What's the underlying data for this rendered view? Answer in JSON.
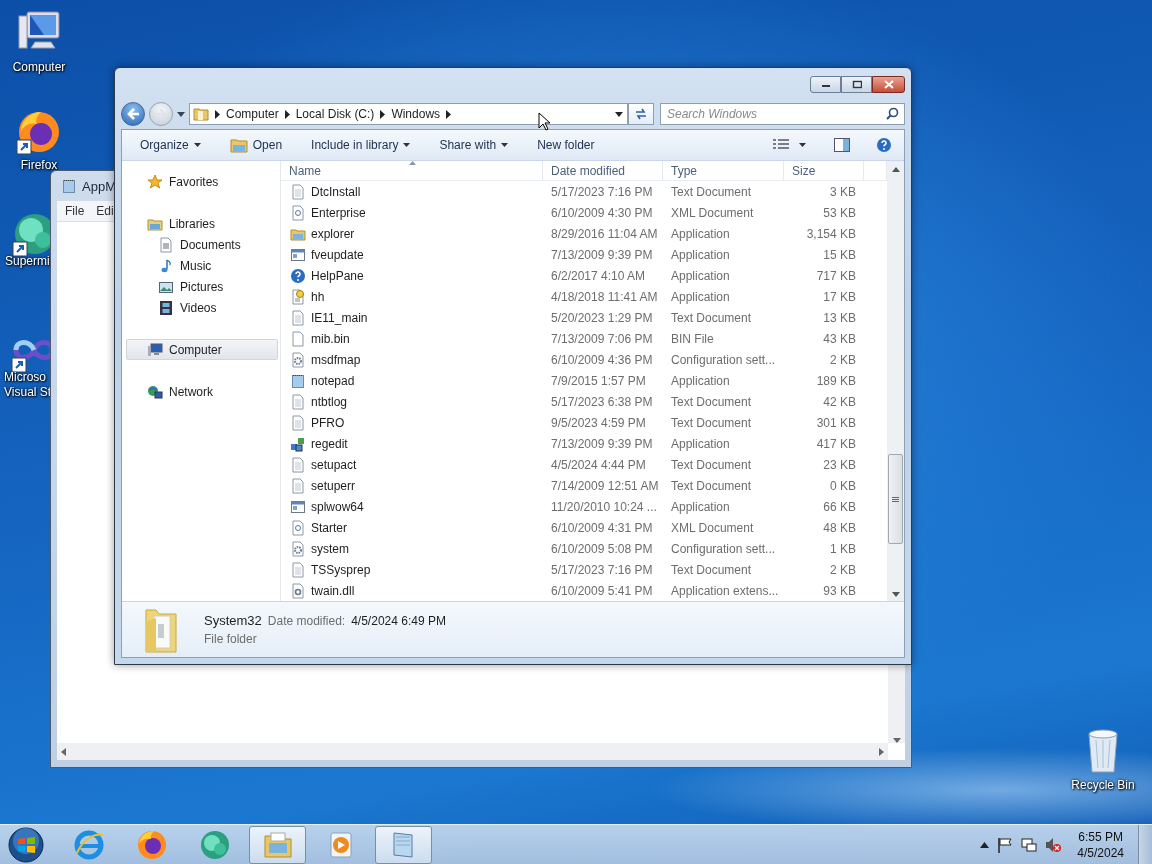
{
  "desktop_icons": [
    {
      "kind": "computer",
      "lines": [
        "Computer"
      ]
    },
    {
      "kind": "browser",
      "lines": [
        "Firefox"
      ]
    },
    {
      "kind": "app",
      "lines": [
        "Supermi"
      ]
    },
    {
      "kind": "studio",
      "lines": [
        "Microso",
        "Visual St"
      ]
    }
  ],
  "background_window": {
    "title": "AppM",
    "menu": [
      "File",
      "Edi"
    ]
  },
  "explorer": {
    "breadcrumbs": [
      "Computer",
      "Local Disk (C:)",
      "Windows"
    ],
    "search": {
      "placeholder": "Search Windows"
    },
    "toolbar": [
      {
        "label": "Organize",
        "kind": "menu"
      },
      {
        "label": "Open",
        "kind": "open"
      },
      {
        "label": "Include in library",
        "kind": "menu"
      },
      {
        "label": "Share with",
        "kind": "menu"
      },
      {
        "label": "New folder",
        "kind": "plain"
      }
    ],
    "nav": [
      {
        "label": "Favorites",
        "kind": "star",
        "selected": false
      },
      {
        "label": "Libraries",
        "kind": "library",
        "selected": false,
        "children": [
          {
            "label": "Documents",
            "kind": "documents",
            "selected": false
          },
          {
            "label": "Music",
            "kind": "music",
            "selected": false
          },
          {
            "label": "Pictures",
            "kind": "pictures",
            "selected": false
          },
          {
            "label": "Videos",
            "kind": "videos",
            "selected": false
          }
        ]
      },
      {
        "label": "Computer",
        "kind": "computer",
        "selected": true
      },
      {
        "label": "Network",
        "kind": "network",
        "selected": false
      }
    ],
    "columns": [
      {
        "label": "Name",
        "sorted": true
      },
      {
        "label": "Date modified",
        "sorted": false
      },
      {
        "label": "Type",
        "sorted": false
      },
      {
        "label": "Size",
        "sorted": false
      }
    ],
    "rows": [
      {
        "name": "DtcInstall",
        "date": "5/17/2023 7:16 PM",
        "type": "Text Document",
        "size": "3 KB",
        "kind": "text"
      },
      {
        "name": "Enterprise",
        "date": "6/10/2009 4:30 PM",
        "type": "XML Document",
        "size": "53 KB",
        "kind": "xml"
      },
      {
        "name": "explorer",
        "date": "8/29/2016 11:04 AM",
        "type": "Application",
        "size": "3,154 KB",
        "kind": "folderapp"
      },
      {
        "name": "fveupdate",
        "date": "7/13/2009 9:39 PM",
        "type": "Application",
        "size": "15 KB",
        "kind": "window"
      },
      {
        "name": "HelpPane",
        "date": "6/2/2017 4:10 AM",
        "type": "Application",
        "size": "717 KB",
        "kind": "help"
      },
      {
        "name": "hh",
        "date": "4/18/2018 11:41 AM",
        "type": "Application",
        "size": "17 KB",
        "kind": "hh"
      },
      {
        "name": "IE11_main",
        "date": "5/20/2023 1:29 PM",
        "type": "Text Document",
        "size": "13 KB",
        "kind": "text"
      },
      {
        "name": "mib.bin",
        "date": "7/13/2009 7:06 PM",
        "type": "BIN File",
        "size": "43 KB",
        "kind": "blank"
      },
      {
        "name": "msdfmap",
        "date": "6/10/2009 4:36 PM",
        "type": "Configuration sett...",
        "size": "2 KB",
        "kind": "config"
      },
      {
        "name": "notepad",
        "date": "7/9/2015 1:57 PM",
        "type": "Application",
        "size": "189 KB",
        "kind": "notepad"
      },
      {
        "name": "ntbtlog",
        "date": "5/17/2023 6:38 PM",
        "type": "Text Document",
        "size": "42 KB",
        "kind": "text"
      },
      {
        "name": "PFRO",
        "date": "9/5/2023 4:59 PM",
        "type": "Text Document",
        "size": "301 KB",
        "kind": "text"
      },
      {
        "name": "regedit",
        "date": "7/13/2009 9:39 PM",
        "type": "Application",
        "size": "417 KB",
        "kind": "regedit"
      },
      {
        "name": "setupact",
        "date": "4/5/2024 4:44 PM",
        "type": "Text Document",
        "size": "23 KB",
        "kind": "text"
      },
      {
        "name": "setuperr",
        "date": "7/14/2009 12:51 AM",
        "type": "Text Document",
        "size": "0 KB",
        "kind": "text"
      },
      {
        "name": "splwow64",
        "date": "11/20/2010 10:24 ...",
        "type": "Application",
        "size": "66 KB",
        "kind": "window"
      },
      {
        "name": "Starter",
        "date": "6/10/2009 4:31 PM",
        "type": "XML Document",
        "size": "48 KB",
        "kind": "xml"
      },
      {
        "name": "system",
        "date": "6/10/2009 5:08 PM",
        "type": "Configuration sett...",
        "size": "1 KB",
        "kind": "config"
      },
      {
        "name": "TSSysprep",
        "date": "5/17/2023 7:16 PM",
        "type": "Text Document",
        "size": "2 KB",
        "kind": "text"
      },
      {
        "name": "twain.dll",
        "date": "6/10/2009 5:41 PM",
        "type": "Application extens...",
        "size": "93 KB",
        "kind": "dll"
      }
    ],
    "details": {
      "name": "System32",
      "date_label": "Date modified:",
      "date": "4/5/2024 6:49 PM",
      "type": "File folder"
    }
  },
  "taskbar": {
    "items": [
      {
        "kind": "ie",
        "active": false
      },
      {
        "kind": "browser",
        "active": false
      },
      {
        "kind": "app",
        "active": false
      },
      {
        "kind": "explorer",
        "active": true
      },
      {
        "kind": "media",
        "active": false
      },
      {
        "kind": "notepad",
        "active": true
      }
    ],
    "time": "6:55 PM",
    "date": "4/5/2024"
  },
  "recycle_bin": {
    "label": "Recycle Bin"
  }
}
